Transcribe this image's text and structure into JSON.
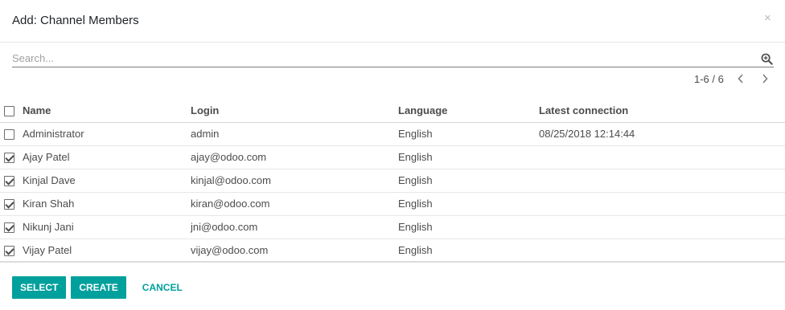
{
  "dialog": {
    "title": "Add: Channel Members",
    "close_label": "×"
  },
  "search": {
    "placeholder": "Search...",
    "icon": "search-plus-icon"
  },
  "pager": {
    "value": "1-6 / 6",
    "prev_icon": "chevron-left-icon",
    "next_icon": "chevron-right-icon"
  },
  "table": {
    "columns": [
      "Name",
      "Login",
      "Language",
      "Latest connection"
    ],
    "rows": [
      {
        "name": "Administrator",
        "login": "admin",
        "language": "English",
        "latest_connection": "08/25/2018 12:14:44",
        "selected": false
      },
      {
        "name": "Ajay Patel",
        "login": "ajay@odoo.com",
        "language": "English",
        "latest_connection": "",
        "selected": true
      },
      {
        "name": "Kinjal Dave",
        "login": "kinjal@odoo.com",
        "language": "English",
        "latest_connection": "",
        "selected": true
      },
      {
        "name": "Kiran Shah",
        "login": "kiran@odoo.com",
        "language": "English",
        "latest_connection": "",
        "selected": true
      },
      {
        "name": "Nikunj Jani",
        "login": "jni@odoo.com",
        "language": "English",
        "latest_connection": "",
        "selected": true
      },
      {
        "name": "Vijay Patel",
        "login": "vijay@odoo.com",
        "language": "English",
        "latest_connection": "",
        "selected": true
      }
    ]
  },
  "footer": {
    "select_label": "SELECT",
    "create_label": "CREATE",
    "cancel_label": "CANCEL"
  },
  "colors": {
    "accent": "#00a09d",
    "text": "#4c4c4c"
  }
}
